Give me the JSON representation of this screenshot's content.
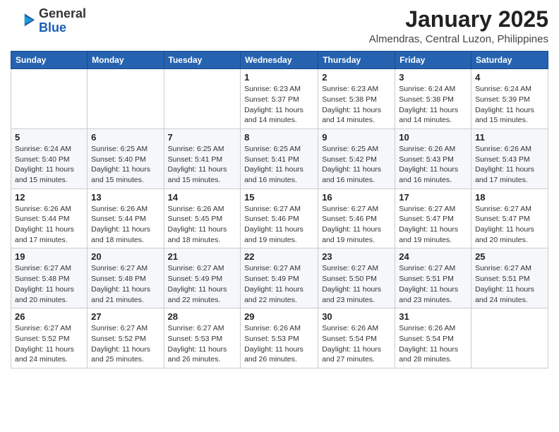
{
  "logo": {
    "general": "General",
    "blue": "Blue"
  },
  "header": {
    "month": "January 2025",
    "location": "Almendras, Central Luzon, Philippines"
  },
  "days_of_week": [
    "Sunday",
    "Monday",
    "Tuesday",
    "Wednesday",
    "Thursday",
    "Friday",
    "Saturday"
  ],
  "weeks": [
    [
      {
        "day": "",
        "info": ""
      },
      {
        "day": "",
        "info": ""
      },
      {
        "day": "",
        "info": ""
      },
      {
        "day": "1",
        "info": "Sunrise: 6:23 AM\nSunset: 5:37 PM\nDaylight: 11 hours and 14 minutes."
      },
      {
        "day": "2",
        "info": "Sunrise: 6:23 AM\nSunset: 5:38 PM\nDaylight: 11 hours and 14 minutes."
      },
      {
        "day": "3",
        "info": "Sunrise: 6:24 AM\nSunset: 5:38 PM\nDaylight: 11 hours and 14 minutes."
      },
      {
        "day": "4",
        "info": "Sunrise: 6:24 AM\nSunset: 5:39 PM\nDaylight: 11 hours and 15 minutes."
      }
    ],
    [
      {
        "day": "5",
        "info": "Sunrise: 6:24 AM\nSunset: 5:40 PM\nDaylight: 11 hours and 15 minutes."
      },
      {
        "day": "6",
        "info": "Sunrise: 6:25 AM\nSunset: 5:40 PM\nDaylight: 11 hours and 15 minutes."
      },
      {
        "day": "7",
        "info": "Sunrise: 6:25 AM\nSunset: 5:41 PM\nDaylight: 11 hours and 15 minutes."
      },
      {
        "day": "8",
        "info": "Sunrise: 6:25 AM\nSunset: 5:41 PM\nDaylight: 11 hours and 16 minutes."
      },
      {
        "day": "9",
        "info": "Sunrise: 6:25 AM\nSunset: 5:42 PM\nDaylight: 11 hours and 16 minutes."
      },
      {
        "day": "10",
        "info": "Sunrise: 6:26 AM\nSunset: 5:43 PM\nDaylight: 11 hours and 16 minutes."
      },
      {
        "day": "11",
        "info": "Sunrise: 6:26 AM\nSunset: 5:43 PM\nDaylight: 11 hours and 17 minutes."
      }
    ],
    [
      {
        "day": "12",
        "info": "Sunrise: 6:26 AM\nSunset: 5:44 PM\nDaylight: 11 hours and 17 minutes."
      },
      {
        "day": "13",
        "info": "Sunrise: 6:26 AM\nSunset: 5:44 PM\nDaylight: 11 hours and 18 minutes."
      },
      {
        "day": "14",
        "info": "Sunrise: 6:26 AM\nSunset: 5:45 PM\nDaylight: 11 hours and 18 minutes."
      },
      {
        "day": "15",
        "info": "Sunrise: 6:27 AM\nSunset: 5:46 PM\nDaylight: 11 hours and 19 minutes."
      },
      {
        "day": "16",
        "info": "Sunrise: 6:27 AM\nSunset: 5:46 PM\nDaylight: 11 hours and 19 minutes."
      },
      {
        "day": "17",
        "info": "Sunrise: 6:27 AM\nSunset: 5:47 PM\nDaylight: 11 hours and 19 minutes."
      },
      {
        "day": "18",
        "info": "Sunrise: 6:27 AM\nSunset: 5:47 PM\nDaylight: 11 hours and 20 minutes."
      }
    ],
    [
      {
        "day": "19",
        "info": "Sunrise: 6:27 AM\nSunset: 5:48 PM\nDaylight: 11 hours and 20 minutes."
      },
      {
        "day": "20",
        "info": "Sunrise: 6:27 AM\nSunset: 5:48 PM\nDaylight: 11 hours and 21 minutes."
      },
      {
        "day": "21",
        "info": "Sunrise: 6:27 AM\nSunset: 5:49 PM\nDaylight: 11 hours and 22 minutes."
      },
      {
        "day": "22",
        "info": "Sunrise: 6:27 AM\nSunset: 5:49 PM\nDaylight: 11 hours and 22 minutes."
      },
      {
        "day": "23",
        "info": "Sunrise: 6:27 AM\nSunset: 5:50 PM\nDaylight: 11 hours and 23 minutes."
      },
      {
        "day": "24",
        "info": "Sunrise: 6:27 AM\nSunset: 5:51 PM\nDaylight: 11 hours and 23 minutes."
      },
      {
        "day": "25",
        "info": "Sunrise: 6:27 AM\nSunset: 5:51 PM\nDaylight: 11 hours and 24 minutes."
      }
    ],
    [
      {
        "day": "26",
        "info": "Sunrise: 6:27 AM\nSunset: 5:52 PM\nDaylight: 11 hours and 24 minutes."
      },
      {
        "day": "27",
        "info": "Sunrise: 6:27 AM\nSunset: 5:52 PM\nDaylight: 11 hours and 25 minutes."
      },
      {
        "day": "28",
        "info": "Sunrise: 6:27 AM\nSunset: 5:53 PM\nDaylight: 11 hours and 26 minutes."
      },
      {
        "day": "29",
        "info": "Sunrise: 6:26 AM\nSunset: 5:53 PM\nDaylight: 11 hours and 26 minutes."
      },
      {
        "day": "30",
        "info": "Sunrise: 6:26 AM\nSunset: 5:54 PM\nDaylight: 11 hours and 27 minutes."
      },
      {
        "day": "31",
        "info": "Sunrise: 6:26 AM\nSunset: 5:54 PM\nDaylight: 11 hours and 28 minutes."
      },
      {
        "day": "",
        "info": ""
      }
    ]
  ]
}
